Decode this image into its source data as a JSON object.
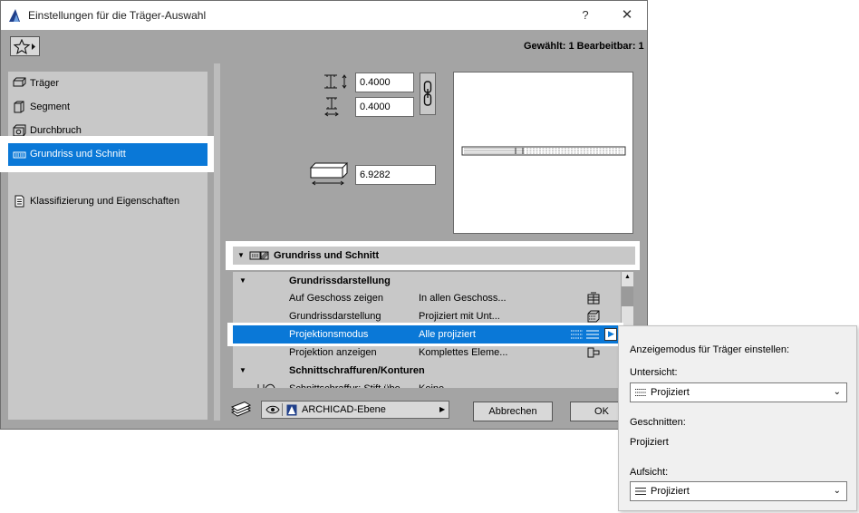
{
  "window": {
    "title": "Einstellungen für die Träger-Auswahl",
    "help": "?",
    "close": "✕"
  },
  "selection_info": "Gewählt: 1 Bearbeitbar: 1",
  "nav": {
    "items": [
      {
        "label": "Träger"
      },
      {
        "label": "Segment"
      },
      {
        "label": "Durchbruch"
      },
      {
        "label": "Grundriss und Schnitt"
      },
      {
        "label": "Klassifizierung und Eigenschaften"
      }
    ]
  },
  "params": {
    "height": "0.4000",
    "width": "0.4000",
    "length": "6.9282"
  },
  "section": {
    "title": "Grundriss und Schnitt"
  },
  "table": {
    "rows": [
      {
        "type": "group",
        "label": "Grundrissdarstellung"
      },
      {
        "type": "row",
        "label": "Auf Geschoss zeigen",
        "value": "In allen Geschoss..."
      },
      {
        "type": "row",
        "label": "Grundrissdarstellung",
        "value": "Projiziert mit Unt..."
      },
      {
        "type": "row",
        "label": "Projektionsmodus",
        "value": "Alle projiziert"
      },
      {
        "type": "row",
        "label": "Projektion anzeigen",
        "value": "Komplettes Eleme..."
      },
      {
        "type": "group",
        "label": "Schnittschraffuren/Konturen"
      },
      {
        "type": "row",
        "label": "Schnittschraffur: Stift übe...",
        "value": "Keine"
      }
    ]
  },
  "bottom": {
    "layer": "ARCHICAD-Ebene",
    "cancel": "Abbrechen",
    "ok": "OK"
  },
  "popup": {
    "title": "Anzeigemodus für Träger einstellen:",
    "untersicht_label": "Untersicht:",
    "untersicht_value": "Projiziert",
    "geschnitten_label": "Geschnitten:",
    "geschnitten_value": "Projiziert",
    "aufsicht_label": "Aufsicht:",
    "aufsicht_value": "Projiziert"
  },
  "colors": {
    "accent": "#0a78d7",
    "dialog_bg": "#a4a4a4",
    "panel_bg": "#c8c8c8"
  }
}
